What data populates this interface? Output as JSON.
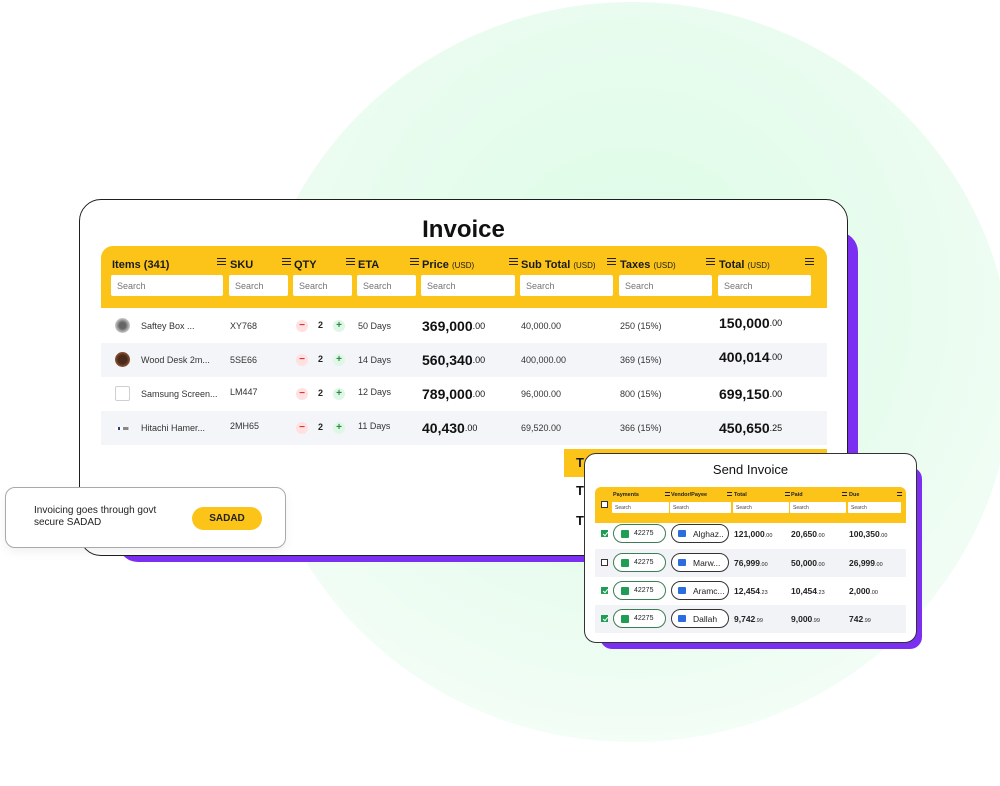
{
  "invoice": {
    "title": "Invoice",
    "columns": [
      {
        "label": "Items (341)",
        "unit": "",
        "search": "Search"
      },
      {
        "label": "SKU",
        "unit": "",
        "search": "Search"
      },
      {
        "label": "QTY",
        "unit": "",
        "search": "Search"
      },
      {
        "label": "ETA",
        "unit": "",
        "search": "Search"
      },
      {
        "label": "Price",
        "unit": "(USD)",
        "search": "Search"
      },
      {
        "label": "Sub Total",
        "unit": "(USD)",
        "search": "Search"
      },
      {
        "label": "Taxes",
        "unit": "(USD)",
        "search": "Search"
      },
      {
        "label": "Total",
        "unit": "(USD)",
        "search": "Search"
      }
    ],
    "rows": [
      {
        "item": "Saftey Box ...",
        "sku": "XY768",
        "qty": "2",
        "eta": "50 Days",
        "price": "369,000",
        "price_dec": ".00",
        "subtotal": "40,000.00",
        "taxes": "250 (15%)",
        "total": "150,000",
        "total_dec": ".00"
      },
      {
        "item": "Wood Desk 2m...",
        "sku": "5SE66",
        "qty": "2",
        "eta": "14 Days",
        "price": "560,340",
        "price_dec": ".00",
        "subtotal": "400,000.00",
        "taxes": "369 (15%)",
        "total": "400,014",
        "total_dec": ".00"
      },
      {
        "item": "Samsung Screen...",
        "sku": "LM447",
        "qty": "2",
        "eta": "12 Days",
        "price": "789,000",
        "price_dec": ".00",
        "subtotal": "96,000.00",
        "taxes": "800 (15%)",
        "total": "699,150",
        "total_dec": ".00"
      },
      {
        "item": "Hitachi Hamer...",
        "sku": "2MH65",
        "qty": "2",
        "eta": "11 Days",
        "price": "40,430",
        "price_dec": ".00",
        "subtotal": "69,520.00",
        "taxes": "366 (15%)",
        "total": "450,650",
        "total_dec": ".25"
      }
    ],
    "qty_minus": "−",
    "qty_plus": "+",
    "totals_letters": [
      "T",
      "T",
      "T"
    ]
  },
  "sadad": {
    "text": "Invoicing goes through govt secure SADAD",
    "button": "SADAD"
  },
  "send_invoice": {
    "title": "Send Invoice",
    "columns": [
      {
        "label": "Payments",
        "search": "Search"
      },
      {
        "label": "Vendor/Payee",
        "search": "Search"
      },
      {
        "label": "Total",
        "search": "Search"
      },
      {
        "label": "Paid",
        "search": "Search"
      },
      {
        "label": "Due",
        "search": "Search"
      }
    ],
    "rows": [
      {
        "checked": true,
        "payment": "42275",
        "vendor": "Alghaz..",
        "total": "121,000",
        "total_dec": ".00",
        "paid": "20,650",
        "paid_dec": ".00",
        "due": "100,350",
        "due_dec": ".00"
      },
      {
        "checked": false,
        "payment": "42275",
        "vendor": "Marw...",
        "total": "76,999",
        "total_dec": ".00",
        "paid": "50,000",
        "paid_dec": ".00",
        "due": "26,999",
        "due_dec": ".00"
      },
      {
        "checked": true,
        "payment": "42275",
        "vendor": "Aramc...",
        "total": "12,454",
        "total_dec": ".23",
        "paid": "10,454",
        "paid_dec": ".23",
        "due": "2,000",
        "due_dec": ".00"
      },
      {
        "checked": true,
        "payment": "42275",
        "vendor": "Dallah",
        "total": "9,742",
        "total_dec": ".99",
        "paid": "9,000",
        "paid_dec": ".99",
        "due": "742",
        "due_dec": ".99"
      }
    ]
  },
  "colors": {
    "accent_yellow": "#fcc419",
    "accent_purple": "#7b2ff0",
    "bg_green": "#e3fbea"
  }
}
